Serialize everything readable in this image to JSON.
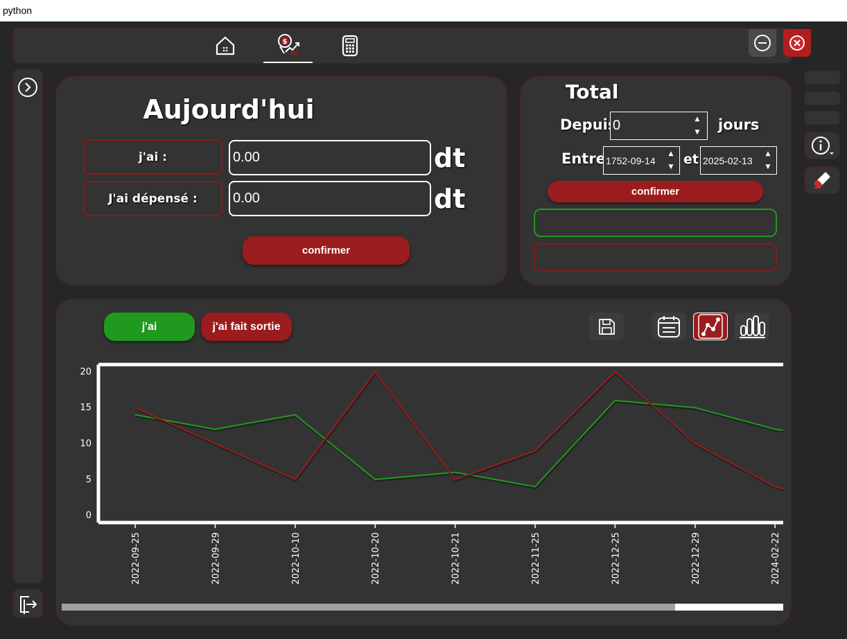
{
  "window": {
    "title": "python"
  },
  "nav": {
    "tabs": [
      {
        "icon": "home-icon",
        "active": false
      },
      {
        "icon": "finance-icon",
        "active": true
      },
      {
        "icon": "calculator-icon",
        "active": false
      }
    ]
  },
  "window_controls": {
    "minimize_icon": "minus-circle-icon",
    "close_icon": "close-circle-icon"
  },
  "today": {
    "title": "Aujourd'hui",
    "have_label": "j'ai :",
    "have_value": "0.00",
    "spent_label": "J'ai dépensé :",
    "spent_value": "0.00",
    "unit": "dt",
    "confirm_label": "confirmer"
  },
  "total": {
    "title": "Total",
    "since_label": "Depuis",
    "since_value": "0",
    "days_label": "jours",
    "between_label": "Entre",
    "start_date": "1752-09-14",
    "and_label": "et",
    "end_date": "2025-02-13",
    "confirm_label": "confirmer"
  },
  "chart_panel": {
    "have_button": "j'ai",
    "out_button": "j'ai fait sortie",
    "tools": [
      "save-icon",
      "calendar-icon",
      "line-chart-icon",
      "bar-chart-icon"
    ],
    "active_tool": "line-chart-icon"
  },
  "colors": {
    "green": "#1f9a1f",
    "red": "#9b1c1c",
    "panel": "#333333",
    "background": "#262626"
  },
  "chart_data": {
    "type": "line",
    "x": [
      "2022-09-25",
      "2022-09-29",
      "2022-10-10",
      "2022-10-20",
      "2022-10-21",
      "2022-11-25",
      "2022-12-25",
      "2022-12-29",
      "2024-02-22"
    ],
    "series": [
      {
        "color": "#1f9a1f",
        "values": [
          14,
          12,
          14,
          5,
          6,
          4,
          16,
          15,
          12
        ]
      },
      {
        "color": "#9b1c1c",
        "values": [
          15,
          10,
          5,
          20,
          5,
          9,
          20,
          10,
          4
        ]
      }
    ],
    "yticks": [
      0,
      5,
      10,
      15,
      20
    ],
    "ylim": [
      -1,
      21
    ],
    "grid": false,
    "scroll_fraction": 0.85
  }
}
